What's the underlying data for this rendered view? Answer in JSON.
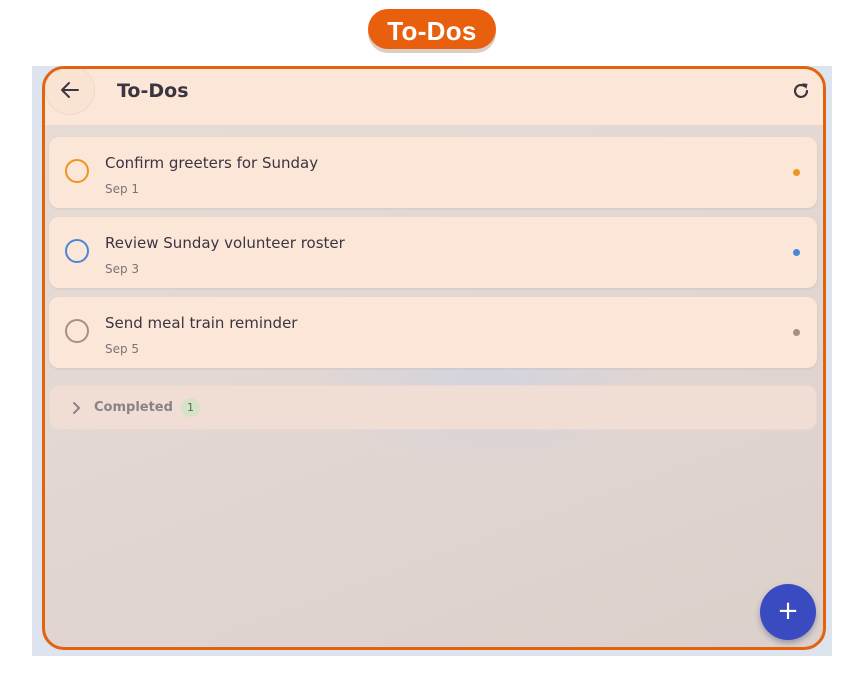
{
  "banner": {
    "label": "To-Dos"
  },
  "appbar": {
    "title": "To-Dos"
  },
  "todos": [
    {
      "title": "Confirm greeters for Sunday",
      "date": "Sep 1",
      "color": "#f0931f"
    },
    {
      "title": "Review Sunday volunteer roster",
      "date": "Sep 3",
      "color": "#4a86d6"
    },
    {
      "title": "Send meal train reminder",
      "date": "Sep 5",
      "color": "#a69085"
    }
  ],
  "completed": {
    "label": "Completed",
    "count": "1"
  },
  "fab": {
    "label": "+"
  },
  "icons": {
    "back": "arrow-left-icon",
    "refresh": "refresh-icon",
    "expand": "chevron-right-icon"
  }
}
